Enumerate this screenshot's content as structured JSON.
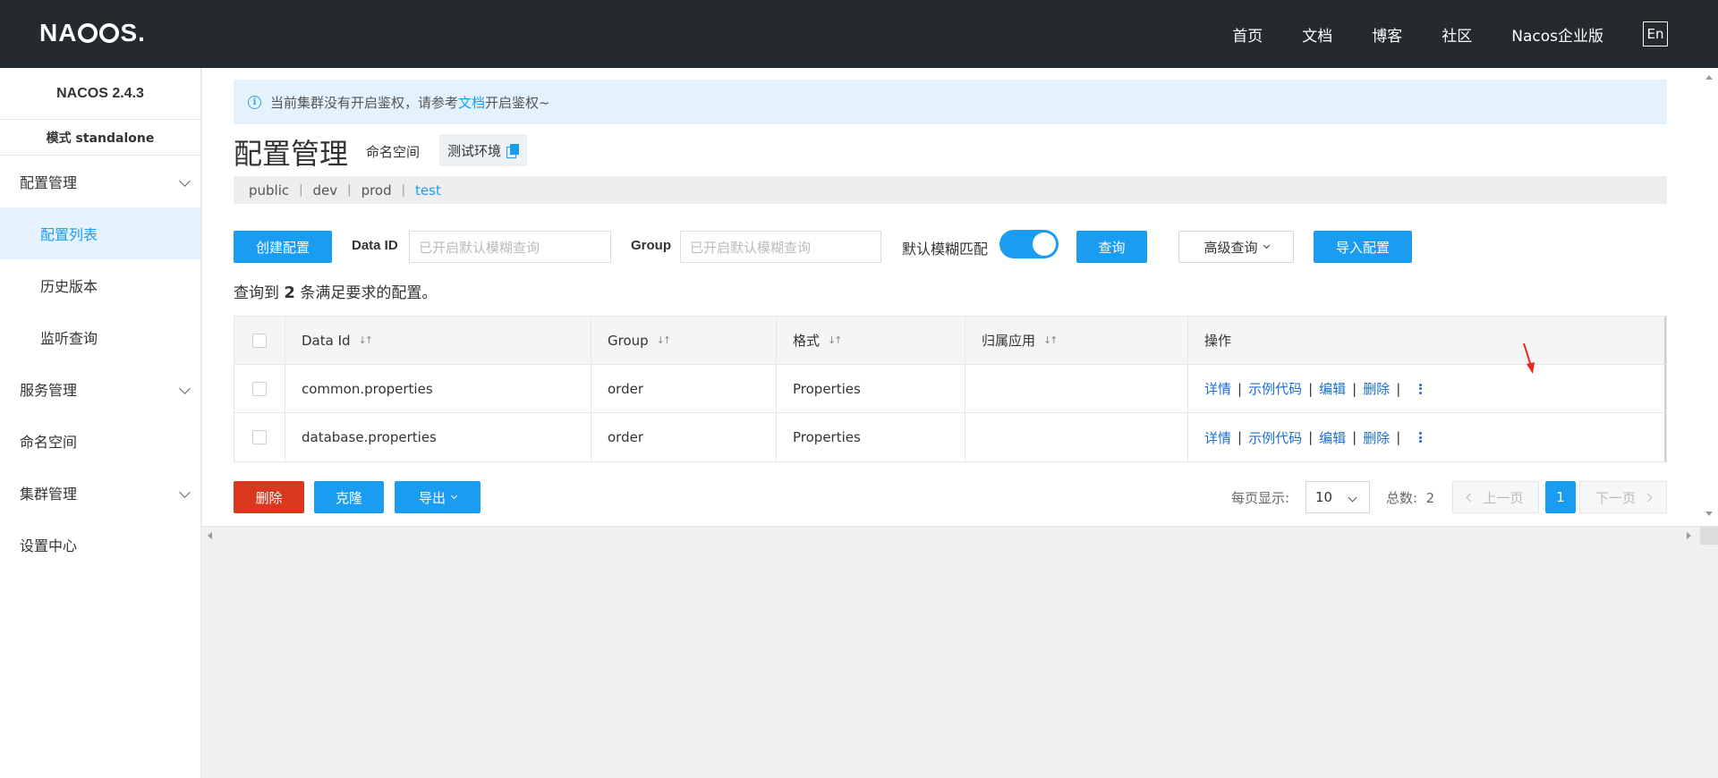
{
  "header": {
    "logo_text": "NACOS.",
    "nav": [
      "首页",
      "文档",
      "博客",
      "社区",
      "Nacos企业版"
    ],
    "lang": "En"
  },
  "sidebar": {
    "version": "NACOS 2.4.3",
    "mode": "模式 standalone",
    "items": [
      {
        "label": "配置管理",
        "expandable": true
      },
      {
        "label": "配置列表",
        "sub": true,
        "active": true
      },
      {
        "label": "历史版本",
        "sub": true
      },
      {
        "label": "监听查询",
        "sub": true
      },
      {
        "label": "服务管理",
        "expandable": true
      },
      {
        "label": "命名空间"
      },
      {
        "label": "集群管理",
        "expandable": true
      },
      {
        "label": "设置中心"
      }
    ]
  },
  "notice": {
    "text_before": "当前集群没有开启鉴权，请参考",
    "link": "文档",
    "text_after": "开启鉴权~"
  },
  "page": {
    "title": "配置管理",
    "namespace_label": "命名空间",
    "namespace_name": "测试环境"
  },
  "namespaces": [
    {
      "label": "public",
      "active": false
    },
    {
      "label": "dev",
      "active": false
    },
    {
      "label": "prod",
      "active": false
    },
    {
      "label": "test",
      "active": true
    }
  ],
  "filters": {
    "create_button": "创建配置",
    "data_id_label": "Data ID",
    "data_id_placeholder": "已开启默认模糊查询",
    "group_label": "Group",
    "group_placeholder": "已开启默认模糊查询",
    "fuzzy_label": "默认模糊匹配",
    "fuzzy_on": true,
    "search_button": "查询",
    "advanced_button": "高级查询",
    "import_button": "导入配置"
  },
  "result": {
    "prefix": "查询到",
    "count": "2",
    "suffix": "条满足要求的配置。"
  },
  "table": {
    "columns": [
      "Data Id",
      "Group",
      "格式",
      "归属应用",
      "操作"
    ],
    "rows": [
      {
        "data_id": "common.properties",
        "group": "order",
        "format": "Properties",
        "app": ""
      },
      {
        "data_id": "database.properties",
        "group": "order",
        "format": "Properties",
        "app": ""
      }
    ],
    "actions": [
      "详情",
      "示例代码",
      "编辑",
      "删除"
    ]
  },
  "bottom": {
    "delete_button": "删除",
    "clone_button": "克隆",
    "export_button": "导出",
    "page_size_label": "每页显示:",
    "page_size": "10",
    "total_label": "总数:",
    "total": "2",
    "prev": "上一页",
    "current_page": "1",
    "next": "下一页"
  },
  "colors": {
    "primary": "#1a9cf0",
    "danger": "#d9381e",
    "header_bg": "#252a2f",
    "annotation_arrow": "#e8261c"
  }
}
